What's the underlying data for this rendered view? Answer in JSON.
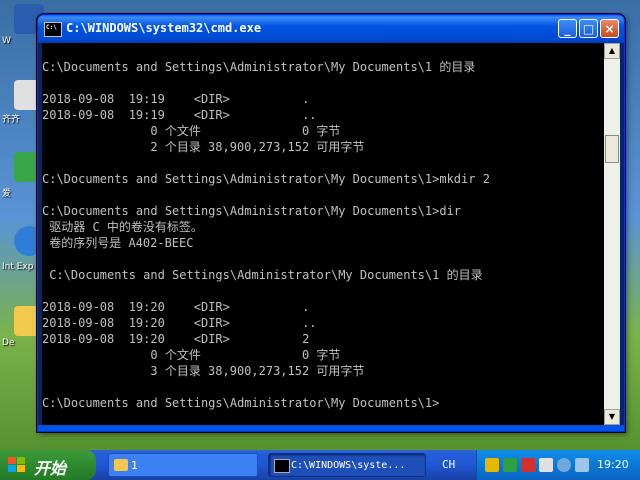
{
  "window": {
    "title": "C:\\WINDOWS\\system32\\cmd.exe",
    "minimize_label": "_",
    "maximize_label": "□",
    "close_label": "×"
  },
  "console": {
    "lines": [
      "",
      "C:\\Documents and Settings\\Administrator\\My Documents\\1 的目录",
      "",
      "2018-09-08  19:19    <DIR>          .",
      "2018-09-08  19:19    <DIR>          ..",
      "               0 个文件              0 字节",
      "               2 个目录 38,900,273,152 可用字节",
      "",
      "C:\\Documents and Settings\\Administrator\\My Documents\\1>mkdir 2",
      "",
      "C:\\Documents and Settings\\Administrator\\My Documents\\1>dir",
      " 驱动器 C 中的卷没有标签。",
      " 卷的序列号是 A402-BEEC",
      "",
      " C:\\Documents and Settings\\Administrator\\My Documents\\1 的目录",
      "",
      "2018-09-08  19:20    <DIR>          .",
      "2018-09-08  19:20    <DIR>          ..",
      "2018-09-08  19:20    <DIR>          2",
      "               0 个文件              0 字节",
      "               3 个目录 38,900,273,152 可用字节",
      "",
      "C:\\Documents and Settings\\Administrator\\My Documents\\1>"
    ]
  },
  "desktop": {
    "icon_labels": [
      "W",
      "齐齐",
      "爱",
      "Int Exp",
      "De"
    ]
  },
  "taskbar": {
    "start_label": "开始",
    "tasks": [
      {
        "label": "1"
      },
      {
        "label": "C:\\WINDOWS\\syste..."
      }
    ],
    "language": "CH",
    "clock": "19:20"
  },
  "colors": {
    "console_bg": "#000000",
    "console_fg": "#c0c0c0",
    "titlebar": "#0054e3",
    "start_green": "#2f8a2f"
  }
}
